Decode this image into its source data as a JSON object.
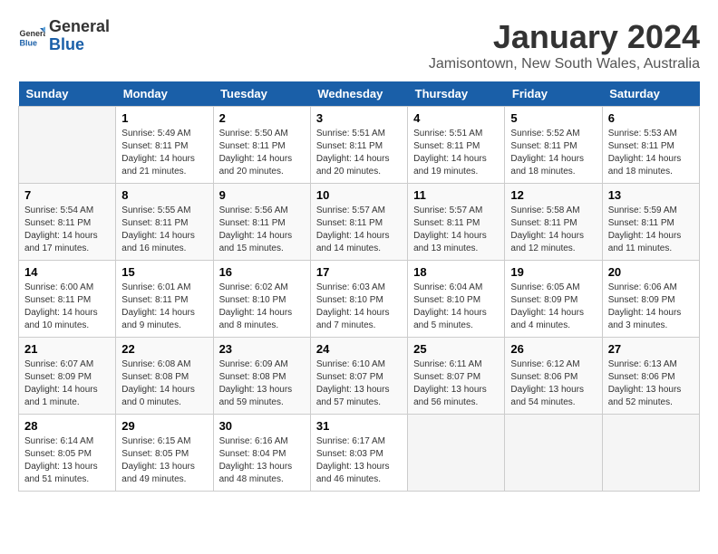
{
  "header": {
    "logo_line1": "General",
    "logo_line2": "Blue",
    "title": "January 2024",
    "subtitle": "Jamisontown, New South Wales, Australia"
  },
  "calendar": {
    "days_of_week": [
      "Sunday",
      "Monday",
      "Tuesday",
      "Wednesday",
      "Thursday",
      "Friday",
      "Saturday"
    ],
    "weeks": [
      [
        {
          "day": "",
          "info": ""
        },
        {
          "day": "1",
          "info": "Sunrise: 5:49 AM\nSunset: 8:11 PM\nDaylight: 14 hours\nand 21 minutes."
        },
        {
          "day": "2",
          "info": "Sunrise: 5:50 AM\nSunset: 8:11 PM\nDaylight: 14 hours\nand 20 minutes."
        },
        {
          "day": "3",
          "info": "Sunrise: 5:51 AM\nSunset: 8:11 PM\nDaylight: 14 hours\nand 20 minutes."
        },
        {
          "day": "4",
          "info": "Sunrise: 5:51 AM\nSunset: 8:11 PM\nDaylight: 14 hours\nand 19 minutes."
        },
        {
          "day": "5",
          "info": "Sunrise: 5:52 AM\nSunset: 8:11 PM\nDaylight: 14 hours\nand 18 minutes."
        },
        {
          "day": "6",
          "info": "Sunrise: 5:53 AM\nSunset: 8:11 PM\nDaylight: 14 hours\nand 18 minutes."
        }
      ],
      [
        {
          "day": "7",
          "info": "Sunrise: 5:54 AM\nSunset: 8:11 PM\nDaylight: 14 hours\nand 17 minutes."
        },
        {
          "day": "8",
          "info": "Sunrise: 5:55 AM\nSunset: 8:11 PM\nDaylight: 14 hours\nand 16 minutes."
        },
        {
          "day": "9",
          "info": "Sunrise: 5:56 AM\nSunset: 8:11 PM\nDaylight: 14 hours\nand 15 minutes."
        },
        {
          "day": "10",
          "info": "Sunrise: 5:57 AM\nSunset: 8:11 PM\nDaylight: 14 hours\nand 14 minutes."
        },
        {
          "day": "11",
          "info": "Sunrise: 5:57 AM\nSunset: 8:11 PM\nDaylight: 14 hours\nand 13 minutes."
        },
        {
          "day": "12",
          "info": "Sunrise: 5:58 AM\nSunset: 8:11 PM\nDaylight: 14 hours\nand 12 minutes."
        },
        {
          "day": "13",
          "info": "Sunrise: 5:59 AM\nSunset: 8:11 PM\nDaylight: 14 hours\nand 11 minutes."
        }
      ],
      [
        {
          "day": "14",
          "info": "Sunrise: 6:00 AM\nSunset: 8:11 PM\nDaylight: 14 hours\nand 10 minutes."
        },
        {
          "day": "15",
          "info": "Sunrise: 6:01 AM\nSunset: 8:11 PM\nDaylight: 14 hours\nand 9 minutes."
        },
        {
          "day": "16",
          "info": "Sunrise: 6:02 AM\nSunset: 8:10 PM\nDaylight: 14 hours\nand 8 minutes."
        },
        {
          "day": "17",
          "info": "Sunrise: 6:03 AM\nSunset: 8:10 PM\nDaylight: 14 hours\nand 7 minutes."
        },
        {
          "day": "18",
          "info": "Sunrise: 6:04 AM\nSunset: 8:10 PM\nDaylight: 14 hours\nand 5 minutes."
        },
        {
          "day": "19",
          "info": "Sunrise: 6:05 AM\nSunset: 8:09 PM\nDaylight: 14 hours\nand 4 minutes."
        },
        {
          "day": "20",
          "info": "Sunrise: 6:06 AM\nSunset: 8:09 PM\nDaylight: 14 hours\nand 3 minutes."
        }
      ],
      [
        {
          "day": "21",
          "info": "Sunrise: 6:07 AM\nSunset: 8:09 PM\nDaylight: 14 hours\nand 1 minute."
        },
        {
          "day": "22",
          "info": "Sunrise: 6:08 AM\nSunset: 8:08 PM\nDaylight: 14 hours\nand 0 minutes."
        },
        {
          "day": "23",
          "info": "Sunrise: 6:09 AM\nSunset: 8:08 PM\nDaylight: 13 hours\nand 59 minutes."
        },
        {
          "day": "24",
          "info": "Sunrise: 6:10 AM\nSunset: 8:07 PM\nDaylight: 13 hours\nand 57 minutes."
        },
        {
          "day": "25",
          "info": "Sunrise: 6:11 AM\nSunset: 8:07 PM\nDaylight: 13 hours\nand 56 minutes."
        },
        {
          "day": "26",
          "info": "Sunrise: 6:12 AM\nSunset: 8:06 PM\nDaylight: 13 hours\nand 54 minutes."
        },
        {
          "day": "27",
          "info": "Sunrise: 6:13 AM\nSunset: 8:06 PM\nDaylight: 13 hours\nand 52 minutes."
        }
      ],
      [
        {
          "day": "28",
          "info": "Sunrise: 6:14 AM\nSunset: 8:05 PM\nDaylight: 13 hours\nand 51 minutes."
        },
        {
          "day": "29",
          "info": "Sunrise: 6:15 AM\nSunset: 8:05 PM\nDaylight: 13 hours\nand 49 minutes."
        },
        {
          "day": "30",
          "info": "Sunrise: 6:16 AM\nSunset: 8:04 PM\nDaylight: 13 hours\nand 48 minutes."
        },
        {
          "day": "31",
          "info": "Sunrise: 6:17 AM\nSunset: 8:03 PM\nDaylight: 13 hours\nand 46 minutes."
        },
        {
          "day": "",
          "info": ""
        },
        {
          "day": "",
          "info": ""
        },
        {
          "day": "",
          "info": ""
        }
      ]
    ]
  }
}
